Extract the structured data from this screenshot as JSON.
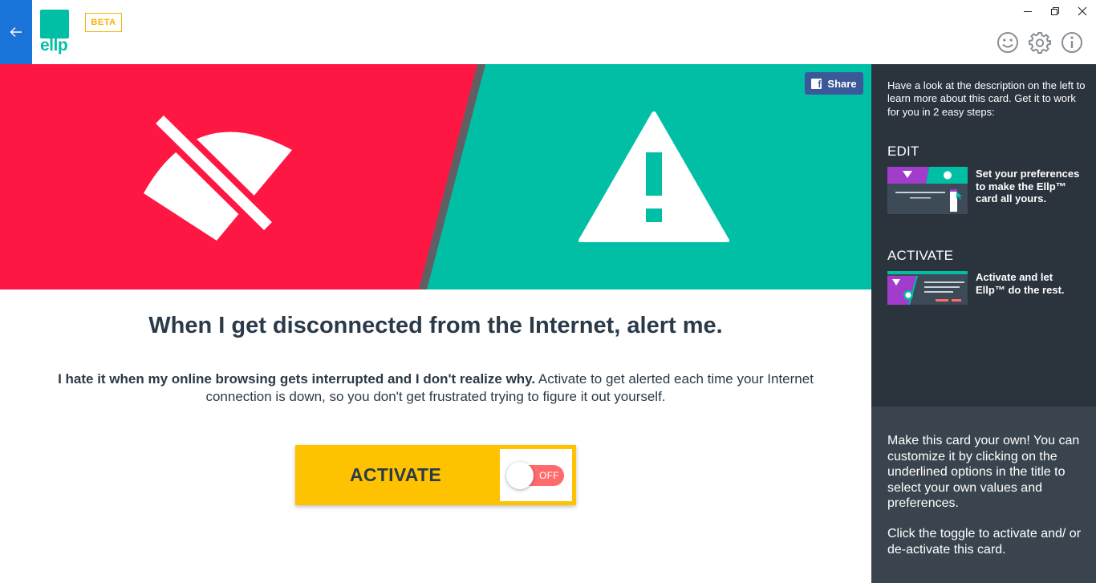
{
  "app": {
    "logo_text": "ellp",
    "beta_label": "BETA"
  },
  "window_controls": [
    "minimize",
    "restore",
    "close"
  ],
  "toolbar": {
    "icons": [
      "feedback-smiley-icon",
      "settings-gear-icon",
      "info-icon"
    ]
  },
  "hero": {
    "left_icon": "wifi-off-icon",
    "right_icon": "warning-triangle-icon",
    "colors": {
      "left": "#ff1744",
      "right": "#00bfa5"
    },
    "share_label": "Share"
  },
  "card": {
    "title": "When I get disconnected from the Internet, alert me.",
    "description_bold": "I hate it when my online browsing gets interrupted and I don't realize why.",
    "description_rest": " Activate to get alerted each time your Internet connection is down, so you don't get frustrated trying to figure it out yourself.",
    "activate_label": "ACTIVATE",
    "toggle_state": "OFF"
  },
  "sidebar": {
    "intro": "Have a look at the description on the left to learn more about this card. Get it to work for you in 2 easy steps:",
    "steps": [
      {
        "title": "EDIT",
        "text": "Set your preferences to make the Ellp™ card all yours."
      },
      {
        "title": "ACTIVATE",
        "text": "Activate and let Ellp™ do the rest."
      }
    ],
    "tips": [
      "Make this card your own! You can customize it by clicking on the underlined options in the title to select your own values and preferences.",
      "Click the toggle to activate and/ or de-activate this card."
    ]
  }
}
